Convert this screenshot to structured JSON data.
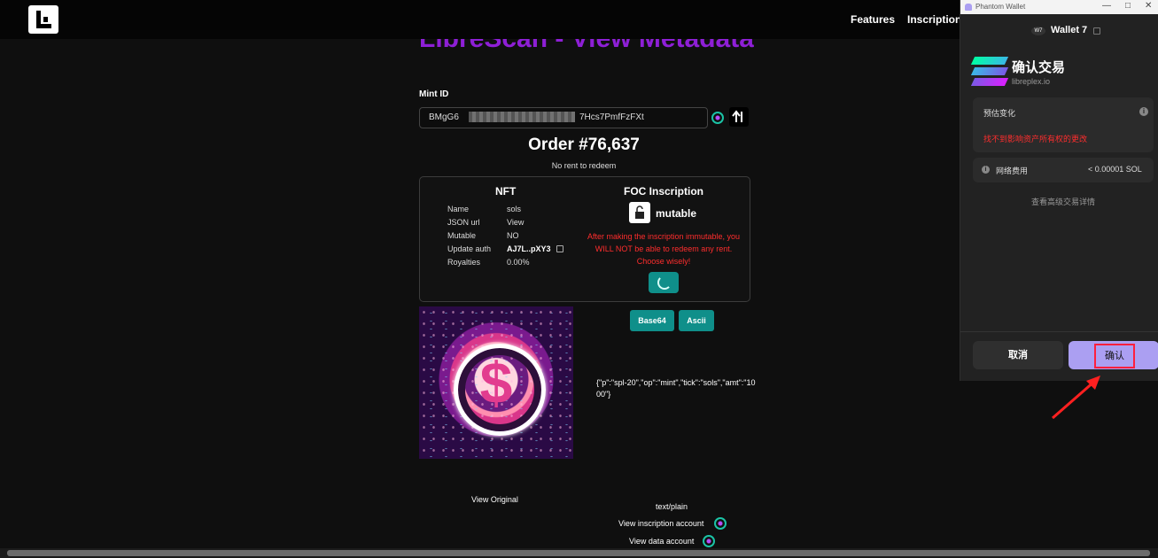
{
  "nav": {
    "links": [
      "Features",
      "Inscriptions"
    ]
  },
  "page": {
    "title": "LibreScan - View Metadata",
    "mint_label": "Mint ID",
    "mint_prefix": "BMgG6",
    "mint_suffix": "7Hcs7PmfFzFXt",
    "order": "Order #76,637",
    "no_rent": "No rent to redeem"
  },
  "nft": {
    "title": "NFT",
    "rows": [
      {
        "key": "Name",
        "value": "sols"
      },
      {
        "key": "JSON url",
        "value": "View"
      },
      {
        "key": "Mutable",
        "value": "NO"
      },
      {
        "key": "Update auth",
        "value": "AJ7L..pXY3"
      },
      {
        "key": "Royalties",
        "value": "0.00%"
      }
    ]
  },
  "foc": {
    "title": "FOC Inscription",
    "status": "mutable",
    "warning": "After making the inscription immutable, you WILL NOT be able to redeem any rent. Choose wisely!"
  },
  "encoding": {
    "base64": "Base64",
    "ascii": "Ascii",
    "content": "{\"p\":\"spl-20\",\"op\":\"mint\",\"tick\":\"sols\",\"amt\":\"1000\"}"
  },
  "links": {
    "view_original": "View Original",
    "mime": "text/plain",
    "view_inscription": "View inscription account",
    "view_data": "View data account"
  },
  "phantom": {
    "window_title": "Phantom Wallet",
    "wallet_badge": "W7",
    "wallet_name": "Wallet 7",
    "confirm_title": "确认交易",
    "origin": "libreplex.io",
    "estimated_changes": "预估变化",
    "no_changes": "找不到影响资产所有权的更改",
    "network_fee_label": "网络费用",
    "network_fee_value": "< 0.00001 SOL",
    "advanced": "查看高级交易详情",
    "cancel": "取消",
    "confirm": "确认"
  },
  "colors": {
    "accent_purple": "#8e1fd6",
    "teal": "#0f8f8a",
    "phantom_purple": "#ab9ff2",
    "warning_red": "#ff2d2d"
  }
}
